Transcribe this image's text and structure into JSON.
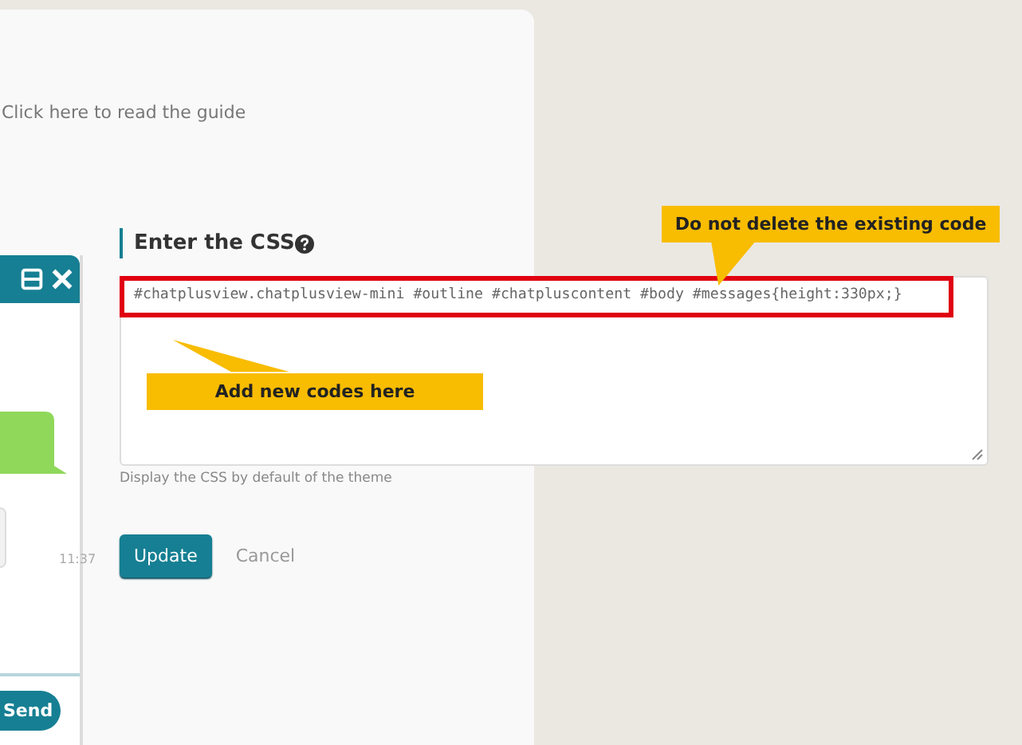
{
  "guide_link": "Click here to read the guide",
  "chat_widget": {
    "time": "11:37",
    "send_button": "Send"
  },
  "css_form": {
    "heading": "Enter the CSS",
    "code": "#chatplusview.chatplusview-mini #outline #chatpluscontent #body #messages{height:330px;}",
    "help_text": "Display the CSS by default of the theme",
    "buttons": [
      {
        "label": "Update",
        "kind": "primary"
      },
      {
        "label": "Cancel",
        "kind": "plain"
      }
    ]
  },
  "callouts": [
    {
      "text": "Do not delete the existing code",
      "kind": "down"
    },
    {
      "text": "Add new codes here",
      "kind": "up"
    }
  ]
}
